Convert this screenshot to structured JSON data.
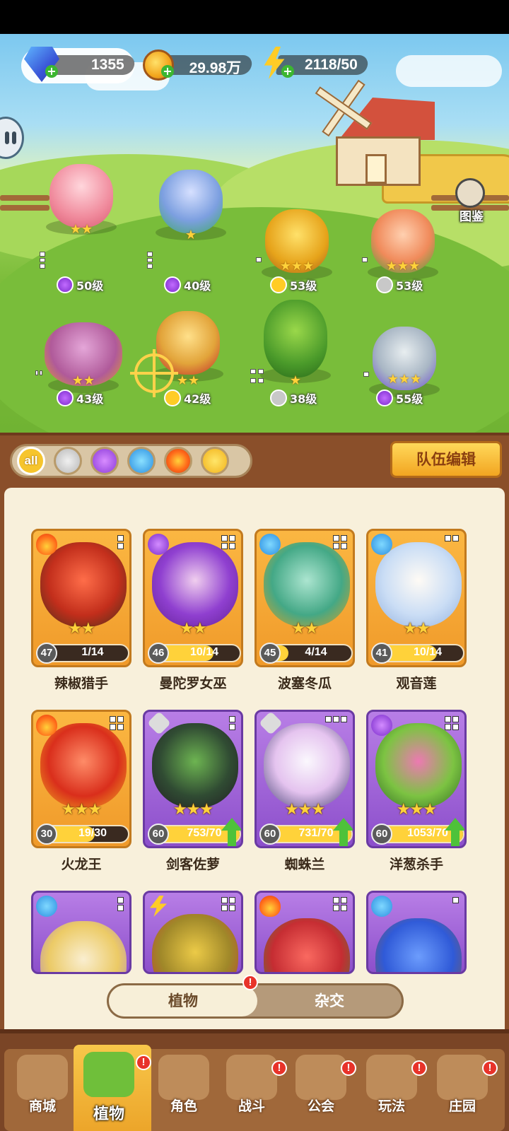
{
  "resources": {
    "gems": "1355",
    "coins": "29.98万",
    "energy": "2118/50"
  },
  "codex_label": "图鉴",
  "team_members": [
    {
      "level": "50级",
      "stars": "★★",
      "type": "potion"
    },
    {
      "level": "40级",
      "stars": "★",
      "type": "potion"
    },
    {
      "level": "53级",
      "stars": "★★★",
      "type": "bolt"
    },
    {
      "level": "53级",
      "stars": "★★★",
      "type": "sword"
    },
    {
      "level": "43级",
      "stars": "★★",
      "type": "potion"
    },
    {
      "level": "42级",
      "stars": "★★",
      "type": "bolt"
    },
    {
      "level": "38级",
      "stars": "★",
      "type": "sword"
    },
    {
      "level": "55级",
      "stars": "★★★",
      "type": "potion"
    }
  ],
  "filters": [
    "all",
    "sword-icon",
    "potion-icon",
    "water-icon",
    "fire-icon",
    "bolt-icon"
  ],
  "team_edit_label": "队伍编辑",
  "cards": [
    {
      "name": "辣椒猎手",
      "level": "47",
      "progress": "1/14",
      "stars": "★★",
      "fill": 0.07
    },
    {
      "name": "曼陀罗女巫",
      "level": "46",
      "progress": "10/14",
      "stars": "★★",
      "fill": 0.71
    },
    {
      "name": "波塞冬瓜",
      "level": "45",
      "progress": "4/14",
      "stars": "★★",
      "fill": 0.29
    },
    {
      "name": "观音莲",
      "level": "41",
      "progress": "10/14",
      "stars": "★★",
      "fill": 0.71
    },
    {
      "name": "火龙王",
      "level": "30",
      "progress": "19/30",
      "stars": "★★★",
      "fill": 0.63
    },
    {
      "name": "剑客佐萝",
      "level": "60",
      "progress": "753/70",
      "stars": "★★★",
      "fill": 1
    },
    {
      "name": "蜘蛛兰",
      "level": "60",
      "progress": "731/70",
      "stars": "★★★",
      "fill": 1
    },
    {
      "name": "洋葱杀手",
      "level": "60",
      "progress": "1053/70",
      "stars": "★★★",
      "fill": 1
    }
  ],
  "toggle": {
    "plants": "植物",
    "hybrid": "杂交"
  },
  "nav": [
    "商城",
    "植物",
    "角色",
    "战斗",
    "公会",
    "玩法",
    "庄园"
  ],
  "badge": "!"
}
